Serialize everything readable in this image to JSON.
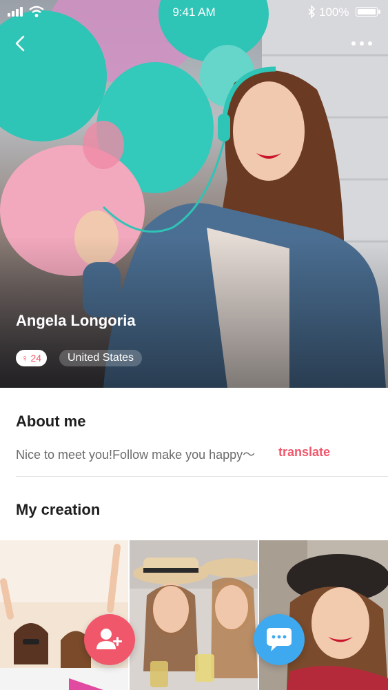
{
  "status_bar": {
    "time": "9:41 AM",
    "battery": "100%"
  },
  "profile": {
    "name": "Angela Longoria",
    "gender_symbol": "♀",
    "age": "24",
    "country": "United States"
  },
  "about": {
    "title": "About me",
    "text": "Nice to meet you!Follow make you happy～",
    "translate_label": "translate"
  },
  "creation": {
    "title": "My creation"
  },
  "icons": [
    "back-icon",
    "more-icon",
    "bluetooth-icon",
    "wifi-icon",
    "add-user-icon",
    "chat-icon"
  ],
  "colors": {
    "accent_pink": "#f0576b",
    "accent_blue": "#3fa9f0",
    "balloon_teal": "#2ec4b6"
  }
}
